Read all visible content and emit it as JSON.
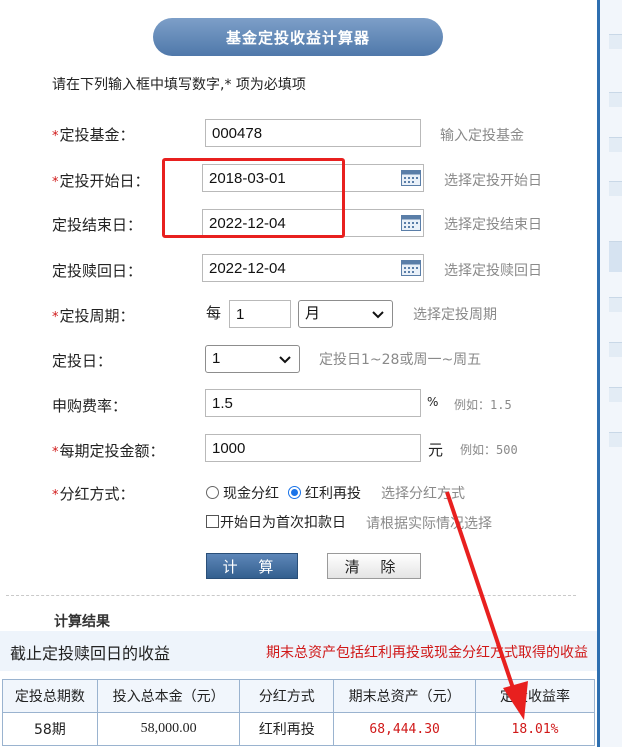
{
  "title": "基金定投收益计算器",
  "intro": "请在下列输入框中填写数字,* 项为必填项",
  "required_mark": "*",
  "fields": {
    "fund": {
      "label": "定投基金：",
      "value": "000478",
      "hint": "输入定投基金"
    },
    "start": {
      "label": "定投开始日：",
      "value": "2018-03-01",
      "hint": "选择定投开始日"
    },
    "end": {
      "label": "定投结束日：",
      "value": "2022-12-04",
      "hint": "选择定投结束日"
    },
    "redeem": {
      "label": "定投赎回日：",
      "value": "2022-12-04",
      "hint": "选择定投赎回日"
    },
    "period": {
      "label": "定投周期：",
      "prefix": "每",
      "value": "1",
      "unit": "月",
      "hint": "选择定投周期"
    },
    "day": {
      "label": "定投日：",
      "value": "1",
      "hint": "定投日1~28或周一~周五"
    },
    "fee": {
      "label": "申购费率：",
      "value": "1.5",
      "unit": "%",
      "hint": "例如：1.5"
    },
    "amount": {
      "label": "每期定投金额：",
      "value": "1000",
      "unit": "元",
      "hint": "例如：500"
    },
    "dividend": {
      "label": "分红方式：",
      "option_cash": "现金分红",
      "option_reinvest": "红利再投",
      "selected": "红利再投",
      "hint": "选择分红方式"
    },
    "first_day": {
      "label": "开始日为首次扣款日",
      "checked": false,
      "hint": "请根据实际情况选择"
    }
  },
  "buttons": {
    "calc": "计 算",
    "clear": "清 除"
  },
  "results": {
    "section_title": "计算结果",
    "header_left": "截止定投赎回日的收益",
    "header_note": "期末总资产包括红利再投或现金分红方式取得的收益",
    "columns": [
      "定投总期数",
      "投入总本金（元）",
      "分红方式",
      "期末总资产（元）",
      "定投收益率"
    ],
    "row": [
      "58期",
      "58,000.00",
      "红利再投",
      "68,444.30",
      "18.01%"
    ]
  },
  "colors": {
    "accent": "#4f78aa",
    "required": "#d01818",
    "annotation": "#e8201f"
  },
  "icons": {
    "calendar": "calendar-icon",
    "dropdown": "chevron-down-icon"
  }
}
